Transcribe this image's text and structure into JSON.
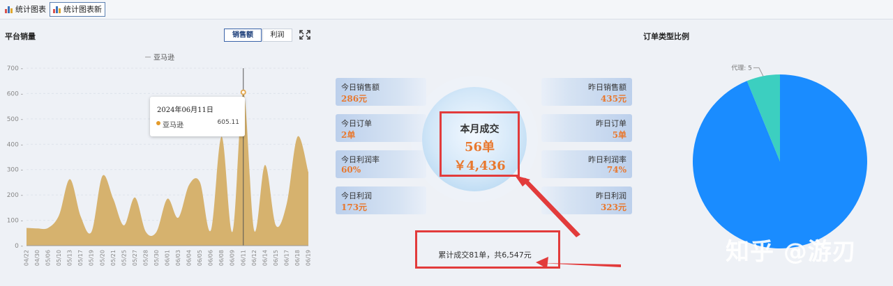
{
  "tabs": [
    {
      "label": "统计图表",
      "active": false
    },
    {
      "label": "统计图表新",
      "active": true
    }
  ],
  "sales_panel": {
    "title": "平台销量",
    "toggles": [
      "销售额",
      "利润"
    ],
    "active_toggle": "销售额"
  },
  "tooltip": {
    "date": "2024年06月11日",
    "series": "亚马逊",
    "value": "605.11"
  },
  "order_panel": {
    "title": "订单类型比例"
  },
  "stats": {
    "today_sales": {
      "label": "今日销售额",
      "value": "286元"
    },
    "yesterday_sales": {
      "label": "昨日销售额",
      "value": "435元"
    },
    "today_orders": {
      "label": "今日订单",
      "value": "2单"
    },
    "yesterday_orders": {
      "label": "昨日订单",
      "value": "5单"
    },
    "today_margin": {
      "label": "今日利润率",
      "value": "60%"
    },
    "yesterday_margin": {
      "label": "昨日利润率",
      "value": "74%"
    },
    "today_profit": {
      "label": "今日利润",
      "value": "173元"
    },
    "yesterday_profit": {
      "label": "昨日利润",
      "value": "323元"
    }
  },
  "month": {
    "title": "本月成交",
    "count": "56单",
    "amount": "￥4,436"
  },
  "cumulative": "累计成交81单，共6,547元",
  "watermark": "知乎 @游刃",
  "colors": {
    "area": "#d6b26e",
    "pie_main": "#1a8cff",
    "pie_minor": "#3ccfc0",
    "highlight": "#e8782e",
    "annotation": "#e23b3b"
  },
  "chart_data": [
    {
      "type": "area",
      "legend": [
        "亚马逊"
      ],
      "legend_position": "top-center",
      "categories": [
        "04/22",
        "04/30",
        "05/06",
        "05/10",
        "05/13",
        "05/17",
        "05/19",
        "05/20",
        "05/21",
        "05/25",
        "05/27",
        "05/28",
        "05/30",
        "06/01",
        "06/03",
        "06/04",
        "06/05",
        "06/06",
        "06/08",
        "06/09",
        "06/11",
        "06/12",
        "06/14",
        "06/15",
        "06/17",
        "06/18",
        "06/19"
      ],
      "series": [
        {
          "name": "亚马逊",
          "values": [
            70,
            68,
            70,
            120,
            262,
            115,
            55,
            275,
            185,
            80,
            190,
            55,
            55,
            185,
            110,
            240,
            250,
            60,
            430,
            55,
            605.11,
            60,
            318,
            80,
            165,
            430,
            290
          ]
        }
      ],
      "ylim": [
        0,
        700
      ],
      "yticks": [
        0,
        100,
        200,
        300,
        400,
        500,
        600,
        700
      ],
      "grid": true,
      "highlight_category": "06/11"
    },
    {
      "type": "pie",
      "labels": [
        "代理",
        ""
      ],
      "values": [
        5,
        76
      ],
      "label_text": [
        "代理: 5",
        ""
      ]
    }
  ]
}
